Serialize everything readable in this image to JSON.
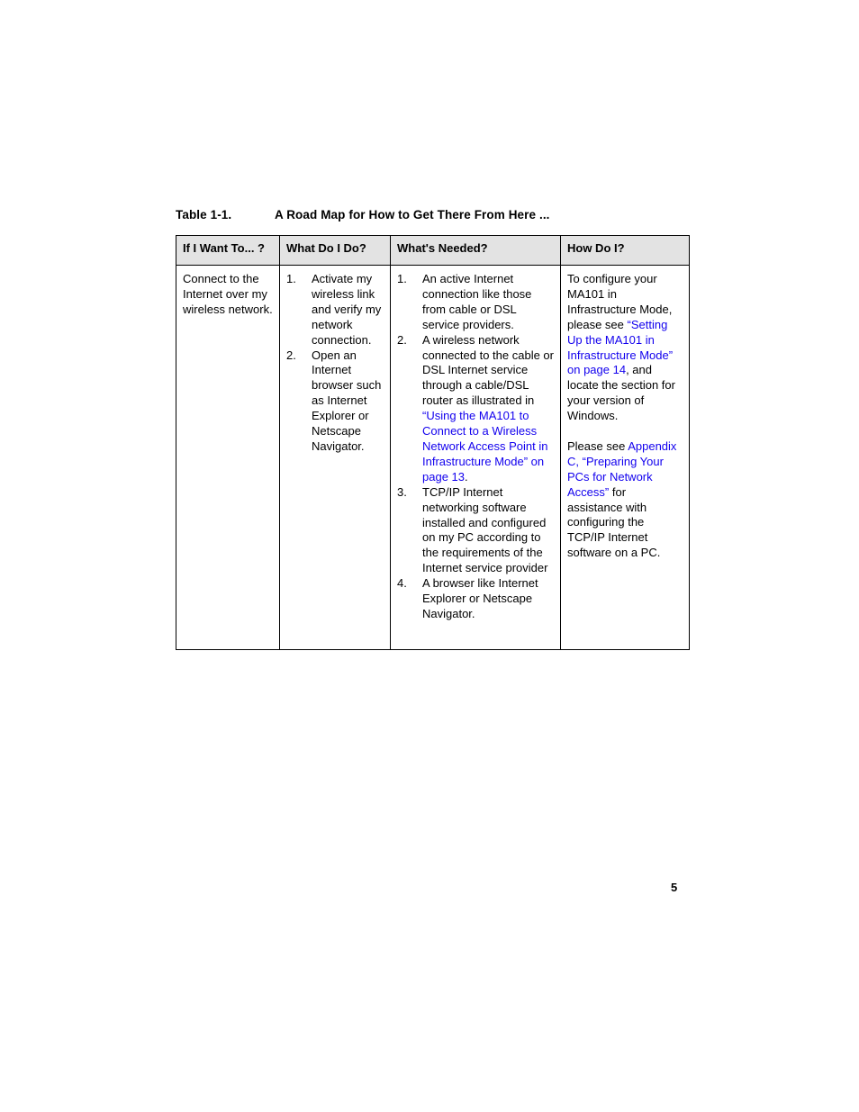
{
  "document": {
    "page_number": "5",
    "link_color": "#1200ee",
    "header_background": "#e3e3e3"
  },
  "table": {
    "caption_number": "Table 1-1.",
    "caption_title": "A Road Map for How to Get There From Here ...",
    "headers": [
      "If I Want To... ?",
      "What Do I Do?",
      "What's Needed?",
      "How Do I?"
    ],
    "rows": [
      {
        "if_i_want_to": "Connect to the Internet over my wireless network.",
        "what_do_i_do": [
          "Activate my wireless link and verify my network connection.",
          "Open an Internet browser such as Internet Explorer or Netscape Navigator."
        ],
        "whats_needed": [
          {
            "segments": [
              {
                "text": "An active Internet connection like those from cable or DSL service providers.",
                "link": false
              }
            ]
          },
          {
            "segments": [
              {
                "text": "A wireless network connected to the cable or DSL Internet service through a cable/DSL router as illustrated in ",
                "link": false
              },
              {
                "text": "“Using the MA101 to Connect to a Wireless Network Access Point in Infrastructure Mode” on page 13",
                "link": true
              },
              {
                "text": ".",
                "link": false
              }
            ]
          },
          {
            "segments": [
              {
                "text": "TCP/IP Internet networking software installed and configured on my PC according to the requirements of the Internet service provider",
                "link": false
              }
            ]
          },
          {
            "segments": [
              {
                "text": "A browser like Internet Explorer or Netscape Navigator.",
                "link": false
              }
            ]
          }
        ],
        "how_do_i": [
          {
            "segments": [
              {
                "text": "To configure your MA101 in Infrastructure Mode, please see ",
                "link": false
              },
              {
                "text": "“Setting Up the MA101 in Infrastructure Mode” on page 14",
                "link": true
              },
              {
                "text": ", and locate the section for your version of Windows.",
                "link": false
              }
            ]
          },
          {
            "spacer": true
          },
          {
            "segments": [
              {
                "text": "Please see ",
                "link": false
              },
              {
                "text": "Appendix C, “Preparing Your PCs for Network Access”",
                "link": true
              },
              {
                "text": " for assistance with configuring the TCP/IP Internet software on a PC.",
                "link": false
              }
            ]
          }
        ]
      }
    ]
  }
}
